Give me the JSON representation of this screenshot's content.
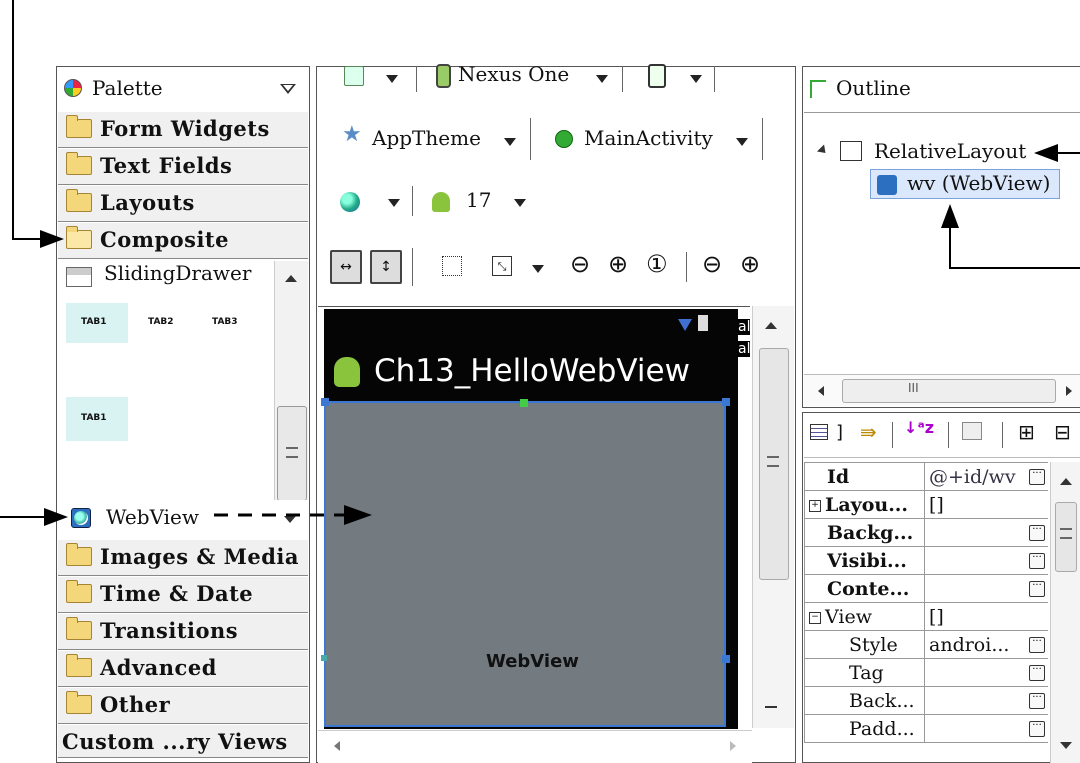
{
  "palette": {
    "title": "Palette",
    "categories_top": [
      "Form Widgets",
      "Text Fields",
      "Layouts",
      "Composite"
    ],
    "items": [
      "SlidingDrawer",
      "TAB1",
      "TAB2",
      "TAB3",
      "TAB1",
      "WebView"
    ],
    "categories_bottom": [
      "Images & Media",
      "Time & Date",
      "Transitions",
      "Advanced",
      "Other",
      "Custom ...ry Views"
    ]
  },
  "toolbar": {
    "device": "Nexus One",
    "theme": "AppTheme",
    "activity": "MainActivity",
    "api": "17"
  },
  "preview": {
    "app_title": "Ch13_HelloWebView",
    "webview_label": "WebView",
    "side_text": [
      "al",
      "al"
    ]
  },
  "outline": {
    "title": "Outline",
    "root": "RelativeLayout",
    "child": "wv (WebView)",
    "scroll_mark": "III"
  },
  "properties": {
    "rows": [
      {
        "name": "Id",
        "value": "@+id/wv",
        "dots": true,
        "bold": true
      },
      {
        "name": "Layou...",
        "value": "[]",
        "expand": "+",
        "bold": true
      },
      {
        "name": "Backg...",
        "value": "",
        "dots": true,
        "bold": true
      },
      {
        "name": "Visibi...",
        "value": "",
        "dots": true,
        "bold": true
      },
      {
        "name": "Conte...",
        "value": "",
        "dots": true,
        "bold": true
      },
      {
        "name": "View",
        "value": "[]",
        "expand": "−",
        "bold": false
      },
      {
        "name": "Style",
        "value": "androi...",
        "dots": true,
        "indent": true
      },
      {
        "name": "Tag",
        "value": "",
        "dots": true,
        "indent": true
      },
      {
        "name": "Back...",
        "value": "",
        "dots": true,
        "indent": true
      },
      {
        "name": "Padd...",
        "value": "",
        "dots": true,
        "indent": true
      }
    ]
  },
  "colors": {
    "preview_gray": "#737b80",
    "selection": "#3a78d4",
    "android_green": "#8ac43c"
  }
}
